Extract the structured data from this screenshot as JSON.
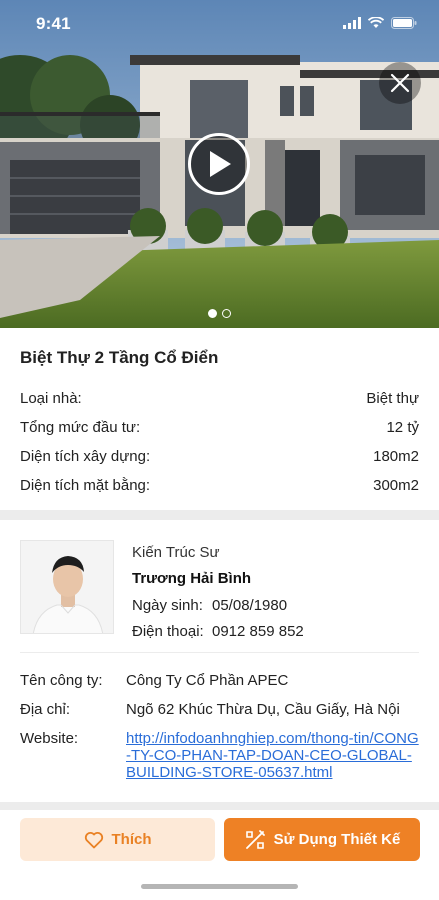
{
  "status_bar": {
    "time": "9:41"
  },
  "hero": {
    "slide_count": 2,
    "active_slide": 1
  },
  "property": {
    "title": "Biệt Thự 2 Tầng Cổ Điển",
    "specs": [
      {
        "label": "Loại nhà:",
        "value": "Biệt thự"
      },
      {
        "label": "Tổng mức đầu tư:",
        "value": "12 tỷ"
      },
      {
        "label": "Diện tích xây dựng:",
        "value": "180m2"
      },
      {
        "label": "Diện tích mặt bằng:",
        "value": "300m2"
      }
    ]
  },
  "architect": {
    "role": "Kiến Trúc Sư",
    "name": "Trương Hải Bình",
    "birth_label": "Ngày sinh:",
    "birth_value": "05/08/1980",
    "phone_label": "Điện thoại:",
    "phone_value": "0912 859 852"
  },
  "company": {
    "name_label": "Tên công ty:",
    "name_value": "Công Ty Cổ Phần APEC",
    "address_label": "Địa chỉ:",
    "address_value": "Ngõ 62 Khúc Thừa Dụ, Cầu Giấy, Hà Nội",
    "website_label": "Website:",
    "website_value": "http://infodoanhnghiep.com/thong-tin/CONG-TY-CO-PHAN-TAP-DOAN-CEO-GLOBAL-BUILDING-STORE-05637.html"
  },
  "actions": {
    "like_label": "Thích",
    "use_label": "Sử Dụng Thiết Kế"
  },
  "colors": {
    "accent": "#ee8125",
    "accent_light": "#fde9d7",
    "link": "#2a6dd8"
  },
  "icons": [
    "close-icon",
    "play-icon",
    "heart-icon",
    "design-tools-icon",
    "signal-icon",
    "wifi-icon",
    "battery-icon"
  ]
}
